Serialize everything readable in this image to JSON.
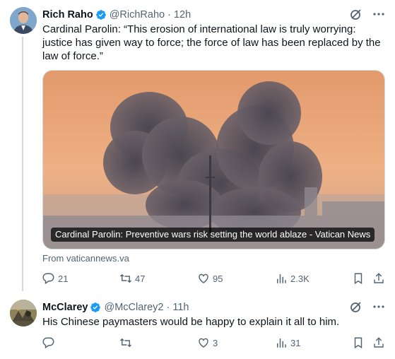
{
  "tweets": [
    {
      "author": "Rich Raho",
      "handle": "@RichRaho",
      "time": "12h",
      "text": "Cardinal Parolin: “This erosion of international law is truly worrying: justice has given way to force; the force of law has been replaced by the law of force.”",
      "card": {
        "caption": "Cardinal Parolin: Preventive wars risk setting the world ablaze - Vatican News",
        "source": "From vaticannews.va"
      },
      "actions": {
        "replies": "21",
        "reposts": "47",
        "likes": "95",
        "views": "2.3K"
      }
    },
    {
      "author": "McClarey",
      "handle": "@McClarey2",
      "time": "11h",
      "text": "His Chinese paymasters would be happy to explain it all to him.",
      "actions": {
        "replies": "",
        "reposts": "",
        "likes": "3",
        "views": "31"
      }
    }
  ],
  "icons": {
    "verified": "verified-badge-icon",
    "grok": "grok-icon",
    "more": "more-icon",
    "reply": "reply-icon",
    "repost": "repost-icon",
    "like": "like-icon",
    "views": "views-icon",
    "bookmark": "bookmark-icon",
    "share": "share-icon"
  },
  "colors": {
    "verified": "#1d9bf0",
    "secondary_text": "#536471",
    "primary_text": "#0f1419"
  }
}
